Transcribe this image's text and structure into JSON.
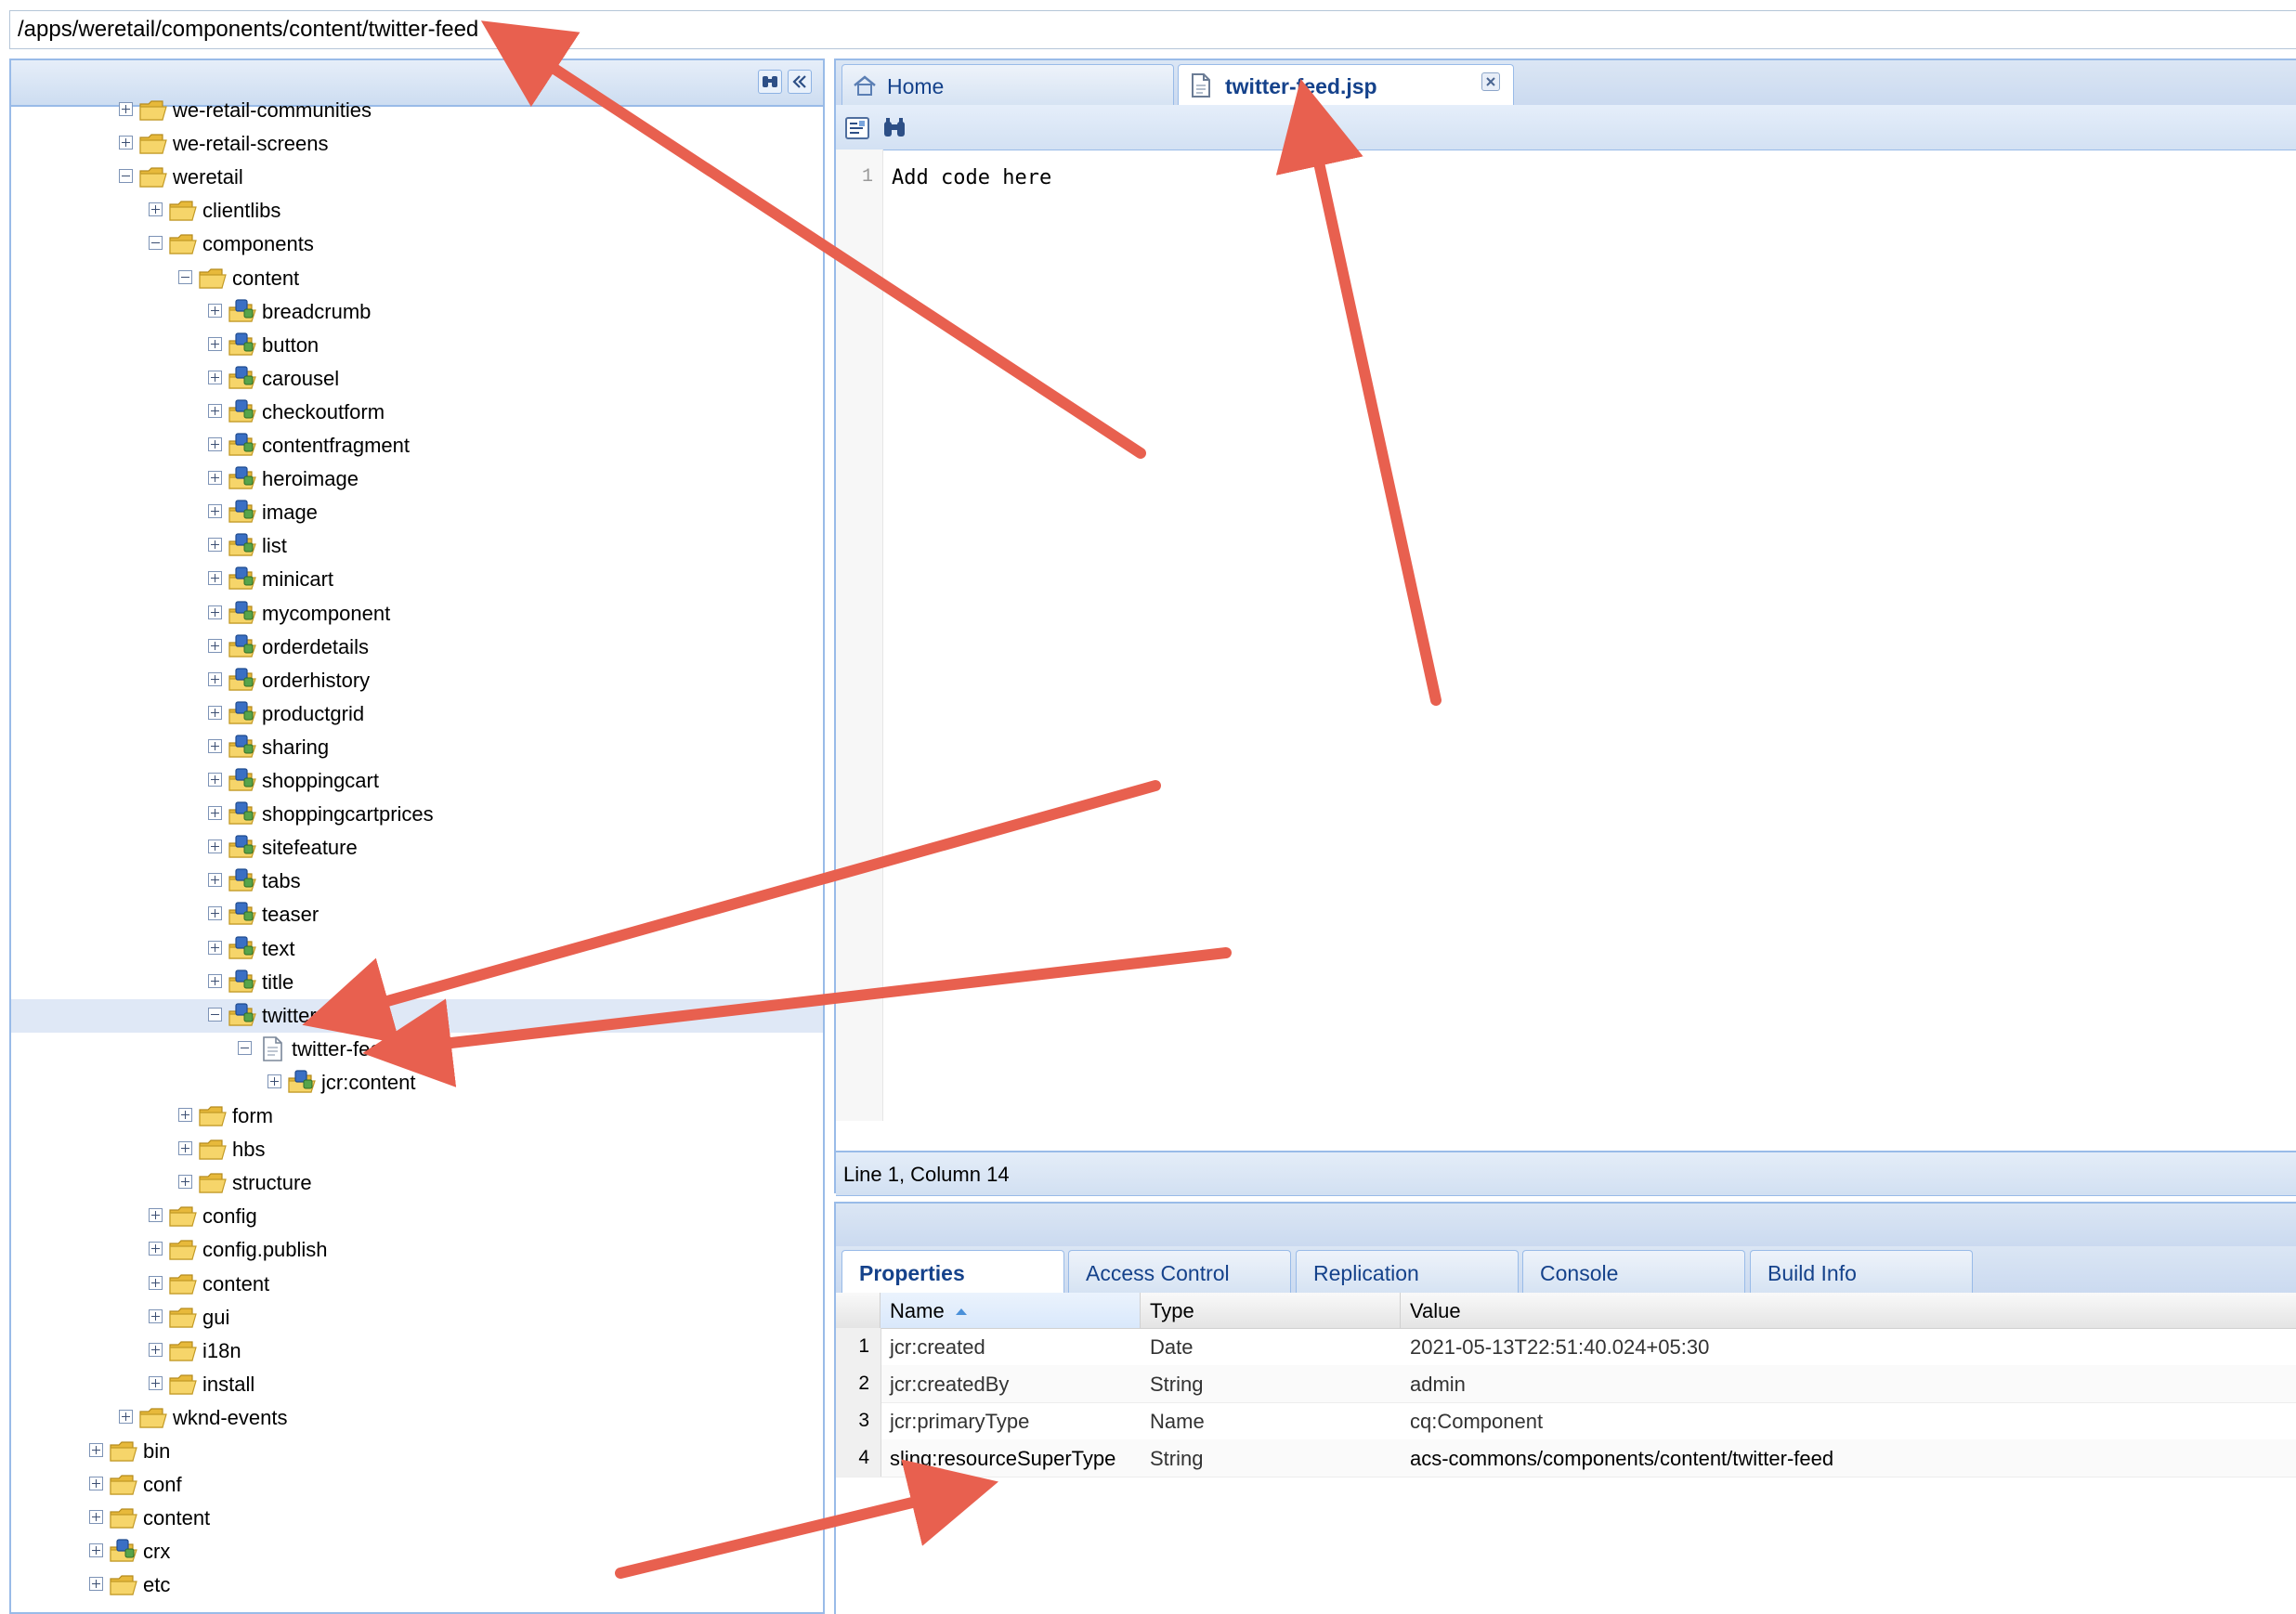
{
  "path_bar": {
    "value": "/apps/weretail/components/content/twitter-feed"
  },
  "tree": {
    "nodes": [
      {
        "label": "we-retail-communities",
        "type": "folder",
        "depth": 2,
        "expanded": false
      },
      {
        "label": "we-retail-screens",
        "type": "folder",
        "depth": 2,
        "expanded": false
      },
      {
        "label": "weretail",
        "type": "folder",
        "depth": 2,
        "expanded": true
      },
      {
        "label": "clientlibs",
        "type": "folder",
        "depth": 3,
        "expanded": false
      },
      {
        "label": "components",
        "type": "folder",
        "depth": 3,
        "expanded": true
      },
      {
        "label": "content",
        "type": "folder",
        "depth": 4,
        "expanded": true
      },
      {
        "label": "breadcrumb",
        "type": "component",
        "depth": 5,
        "expanded": false
      },
      {
        "label": "button",
        "type": "component",
        "depth": 5,
        "expanded": false
      },
      {
        "label": "carousel",
        "type": "component",
        "depth": 5,
        "expanded": false
      },
      {
        "label": "checkoutform",
        "type": "component",
        "depth": 5,
        "expanded": false
      },
      {
        "label": "contentfragment",
        "type": "component",
        "depth": 5,
        "expanded": false
      },
      {
        "label": "heroimage",
        "type": "component",
        "depth": 5,
        "expanded": false
      },
      {
        "label": "image",
        "type": "component",
        "depth": 5,
        "expanded": false
      },
      {
        "label": "list",
        "type": "component",
        "depth": 5,
        "expanded": false
      },
      {
        "label": "minicart",
        "type": "component",
        "depth": 5,
        "expanded": false
      },
      {
        "label": "mycomponent",
        "type": "component",
        "depth": 5,
        "expanded": false
      },
      {
        "label": "orderdetails",
        "type": "component",
        "depth": 5,
        "expanded": false
      },
      {
        "label": "orderhistory",
        "type": "component",
        "depth": 5,
        "expanded": false
      },
      {
        "label": "productgrid",
        "type": "component",
        "depth": 5,
        "expanded": false
      },
      {
        "label": "sharing",
        "type": "component",
        "depth": 5,
        "expanded": false
      },
      {
        "label": "shoppingcart",
        "type": "component",
        "depth": 5,
        "expanded": false
      },
      {
        "label": "shoppingcartprices",
        "type": "component",
        "depth": 5,
        "expanded": false
      },
      {
        "label": "sitefeature",
        "type": "component",
        "depth": 5,
        "expanded": false
      },
      {
        "label": "tabs",
        "type": "component",
        "depth": 5,
        "expanded": false
      },
      {
        "label": "teaser",
        "type": "component",
        "depth": 5,
        "expanded": false
      },
      {
        "label": "text",
        "type": "component",
        "depth": 5,
        "expanded": false
      },
      {
        "label": "title",
        "type": "component",
        "depth": 5,
        "expanded": false
      },
      {
        "label": "twitter-feed",
        "type": "component",
        "depth": 5,
        "expanded": true,
        "selected": true
      },
      {
        "label": "twitter-feed.jsp",
        "type": "file",
        "depth": 6,
        "expanded": true
      },
      {
        "label": "jcr:content",
        "type": "component",
        "depth": 7,
        "expanded": false
      },
      {
        "label": "form",
        "type": "folder",
        "depth": 4,
        "expanded": false
      },
      {
        "label": "hbs",
        "type": "folder",
        "depth": 4,
        "expanded": false
      },
      {
        "label": "structure",
        "type": "folder",
        "depth": 4,
        "expanded": false
      },
      {
        "label": "config",
        "type": "folder",
        "depth": 3,
        "expanded": false
      },
      {
        "label": "config.publish",
        "type": "folder",
        "depth": 3,
        "expanded": false
      },
      {
        "label": "content",
        "type": "folder",
        "depth": 3,
        "expanded": false
      },
      {
        "label": "gui",
        "type": "folder",
        "depth": 3,
        "expanded": false
      },
      {
        "label": "i18n",
        "type": "folder",
        "depth": 3,
        "expanded": false
      },
      {
        "label": "install",
        "type": "folder",
        "depth": 3,
        "expanded": false
      },
      {
        "label": "wknd-events",
        "type": "folder",
        "depth": 2,
        "expanded": false
      },
      {
        "label": "bin",
        "type": "folder",
        "depth": 1,
        "expanded": false
      },
      {
        "label": "conf",
        "type": "folder",
        "depth": 1,
        "expanded": false
      },
      {
        "label": "content",
        "type": "folder",
        "depth": 1,
        "expanded": false
      },
      {
        "label": "crx",
        "type": "component",
        "depth": 1,
        "expanded": false
      },
      {
        "label": "etc",
        "type": "folder",
        "depth": 1,
        "expanded": false
      }
    ]
  },
  "editor": {
    "tabs": [
      {
        "label": "Home",
        "icon": "home-icon",
        "active": false
      },
      {
        "label": "twitter-feed.jsp",
        "icon": "file-icon",
        "active": true
      }
    ],
    "toolbar": {
      "icons": [
        "format-icon",
        "binoculars-icon"
      ]
    },
    "lines": [
      {
        "number": "1",
        "code": "Add code here"
      }
    ],
    "status": "Line 1, Column 14"
  },
  "properties": {
    "tabs": [
      "Properties",
      "Access Control",
      "Replication",
      "Console",
      "Build Info"
    ],
    "active_tab": "Properties",
    "columns": [
      "Name",
      "Type",
      "Value"
    ],
    "rows": [
      {
        "num": "1",
        "name": "jcr:created",
        "type": "Date",
        "value": "2021-05-13T22:51:40.024+05:30"
      },
      {
        "num": "2",
        "name": "jcr:createdBy",
        "type": "String",
        "value": "admin"
      },
      {
        "num": "3",
        "name": "jcr:primaryType",
        "type": "Name",
        "value": "cq:Component"
      },
      {
        "num": "4",
        "name": "sling:resourceSuperType",
        "type": "String",
        "value": "acs-commons/components/content/twitter-feed"
      }
    ]
  },
  "colors": {
    "accent_blue": "#15428b",
    "panel_border": "#99bbe8",
    "arrow": "#e8604f",
    "folder": "#f2c94c"
  }
}
